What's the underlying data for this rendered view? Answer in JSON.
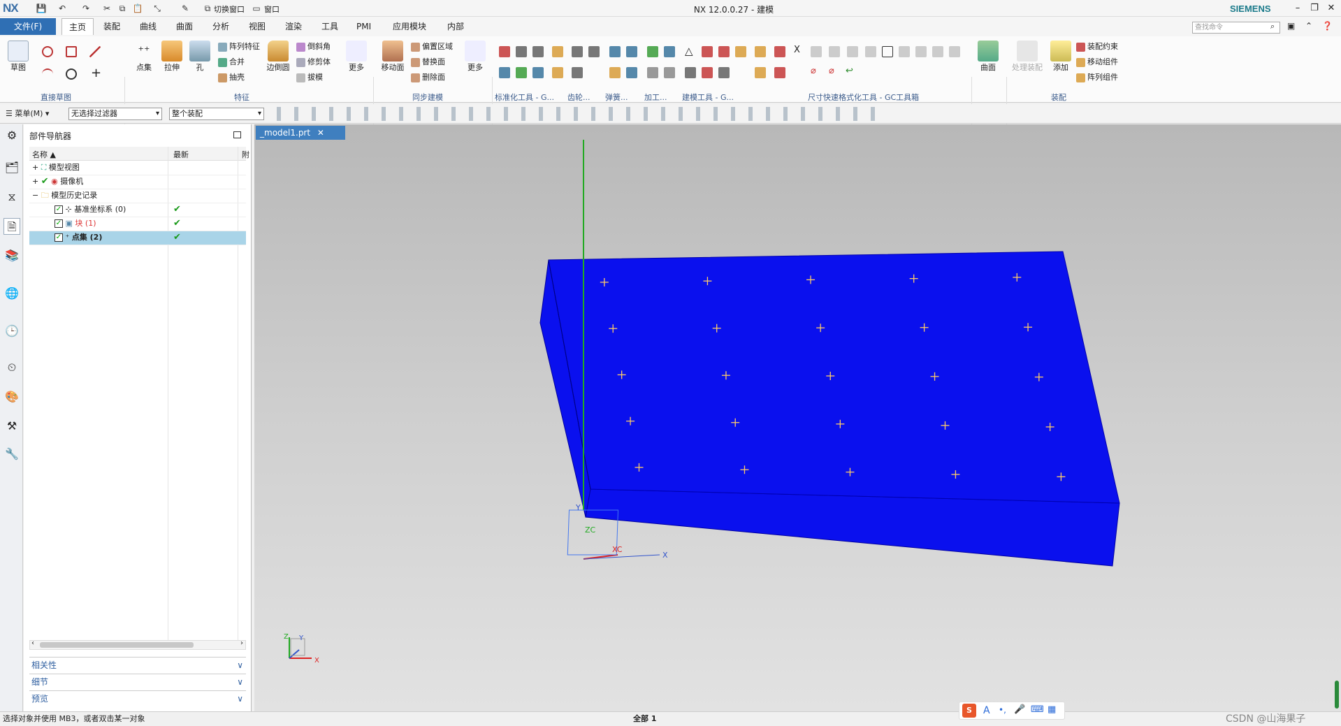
{
  "titlebar": {
    "logo": "NX",
    "title": "NX 12.0.0.27 - 建模",
    "brand": "SIEMENS",
    "switch_window": "切换窗口",
    "window_menu": "窗口"
  },
  "menu": {
    "file": "文件(F)",
    "tabs": [
      "主页",
      "装配",
      "曲线",
      "曲面",
      "分析",
      "视图",
      "渲染",
      "工具",
      "PMI",
      "应用模块",
      "内部"
    ],
    "search_placeholder": "查找命令"
  },
  "ribbon": {
    "sketch": "草图",
    "direct_sketch": "直接草图",
    "point_set": "点集",
    "extrude": "拉伸",
    "hole": "孔",
    "array_feature": "阵列特征",
    "unite": "合并",
    "shell": "抽壳",
    "edge_blend": "边倒圆",
    "chamfer": "倒斜角",
    "trim_body": "修剪体",
    "draft": "拔模",
    "more": "更多",
    "feature": "特征",
    "move_face": "移动面",
    "offset_region": "偏置区域",
    "replace_face": "替换面",
    "delete_face": "删除面",
    "more2": "更多",
    "sync_modeling": "同步建模",
    "std_tools": "标准化工具 - G...",
    "gear": "齿轮...",
    "spring": "弹簧...",
    "machining": "加工...",
    "modeling_tools": "建模工具 - G...",
    "dim_tools": "尺寸快速格式化工具 - GC工具箱",
    "surface": "曲面",
    "process_assembly": "处理装配",
    "add": "添加",
    "assembly_constraint": "装配约束",
    "move_component": "移动组件",
    "array_component": "阵列组件",
    "assembly": "装配"
  },
  "selbar": {
    "menu": "菜单(M)",
    "filter": "无选择过滤器",
    "scope": "整个装配"
  },
  "navigator": {
    "title": "部件导航器",
    "col_name": "名称",
    "col_latest": "最新",
    "col_extra": "附",
    "rows": [
      {
        "label": "模型视图"
      },
      {
        "label": "摄像机"
      },
      {
        "label": "模型历史记录"
      },
      {
        "label": "基准坐标系 (0)"
      },
      {
        "label": "块 (1)"
      },
      {
        "label": "点集 (2)"
      }
    ],
    "panels": [
      "相关性",
      "细节",
      "预览"
    ]
  },
  "graphics": {
    "doc_tab": "_model1.prt",
    "axis_x": "X",
    "axis_y": "Y",
    "axis_z": "Z",
    "wcs_x": "XC",
    "wcs_z": "ZC",
    "block_color": "#0a10ee",
    "point_rows": 5,
    "point_cols": 5
  },
  "status": {
    "hint": "选择对象并使用 MB3，或者双击某一对象",
    "count": "全部 1",
    "watermark": "CSDN @山海果子"
  }
}
